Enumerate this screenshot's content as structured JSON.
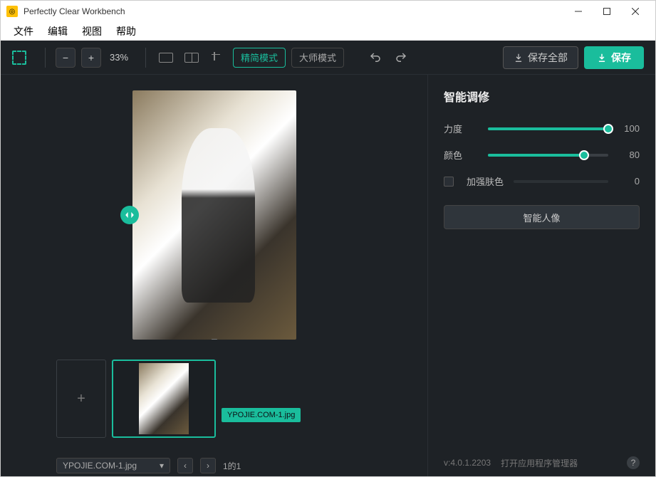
{
  "window": {
    "title": "Perfectly Clear Workbench"
  },
  "menu": {
    "file": "文件",
    "edit": "编辑",
    "view": "视图",
    "help": "帮助"
  },
  "toolbar": {
    "zoom_pct": "33%",
    "mode_simple": "精简模式",
    "mode_master": "大师模式",
    "save_all": "保存全部",
    "save": "保存"
  },
  "filmstrip": {
    "thumb_label": "YPOJIE.COM-1.jpg",
    "file_dropdown": "YPOJIE.COM-1.jpg",
    "position": "1的1"
  },
  "panel": {
    "title": "智能调修",
    "strength_label": "力度",
    "strength_value": "100",
    "color_label": "颜色",
    "color_value": "80",
    "skin_label": "加强肤色",
    "skin_value": "0",
    "portrait_btn": "智能人像"
  },
  "footer": {
    "version": "v:4.0.1.2203",
    "manager": "打开应用程序管理器"
  }
}
